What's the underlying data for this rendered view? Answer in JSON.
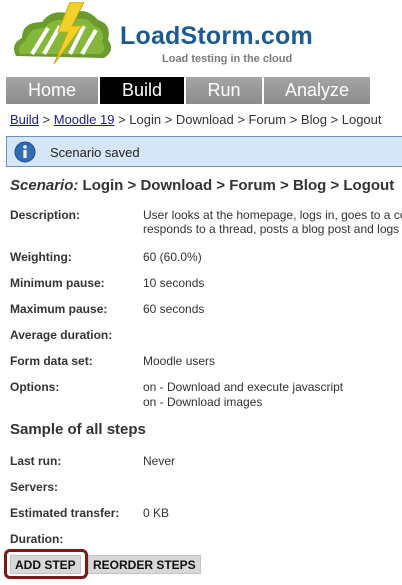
{
  "header": {
    "brand": "LoadStorm.com",
    "tagline": "Load testing in the cloud"
  },
  "nav": {
    "tabs": [
      {
        "label": "Home",
        "active": false
      },
      {
        "label": "Build",
        "active": true
      },
      {
        "label": "Run",
        "active": false
      },
      {
        "label": "Analyze",
        "active": false
      }
    ]
  },
  "breadcrumb": {
    "build": "Build",
    "sep1": " > ",
    "project": "Moodle 19",
    "rest": " > Login > Download > Forum > Blog > Logout"
  },
  "notice": {
    "icon": "info-icon",
    "text": "Scenario saved"
  },
  "scenario": {
    "label": "Scenario:",
    "name": "Login > Download > Forum > Blog > Logout"
  },
  "fields": {
    "description_label": "Description:",
    "description_line1": "User looks at the homepage, logs in, goes to a co",
    "description_line2": "responds to a thread, posts a blog post and logs o",
    "weighting_label": "Weighting:",
    "weighting_value": "60 (60.0%)",
    "min_pause_label": "Minimum pause:",
    "min_pause_value": "10 seconds",
    "max_pause_label": "Maximum pause:",
    "max_pause_value": "60 seconds",
    "avg_duration_label": "Average duration:",
    "form_data_label": "Form data set:",
    "form_data_value": "Moodle users",
    "options_label": "Options:",
    "options_line1": "on - Download and execute javascript",
    "options_line2": "on - Download images"
  },
  "sample": {
    "title": "Sample of all steps",
    "last_run_label": "Last run:",
    "last_run_value": "Never",
    "servers_label": "Servers:",
    "transfer_label": "Estimated transfer:",
    "transfer_value": "0 KB",
    "duration_label": "Duration:"
  },
  "actions": {
    "add_step": "ADD STEP",
    "reorder_steps": "REORDER STEPS"
  },
  "colors": {
    "brand_blue": "#1b5b91",
    "logo_green": "#6a9b2c",
    "bolt_yellow": "#f2d22a",
    "highlight_ring": "#7b1818"
  }
}
